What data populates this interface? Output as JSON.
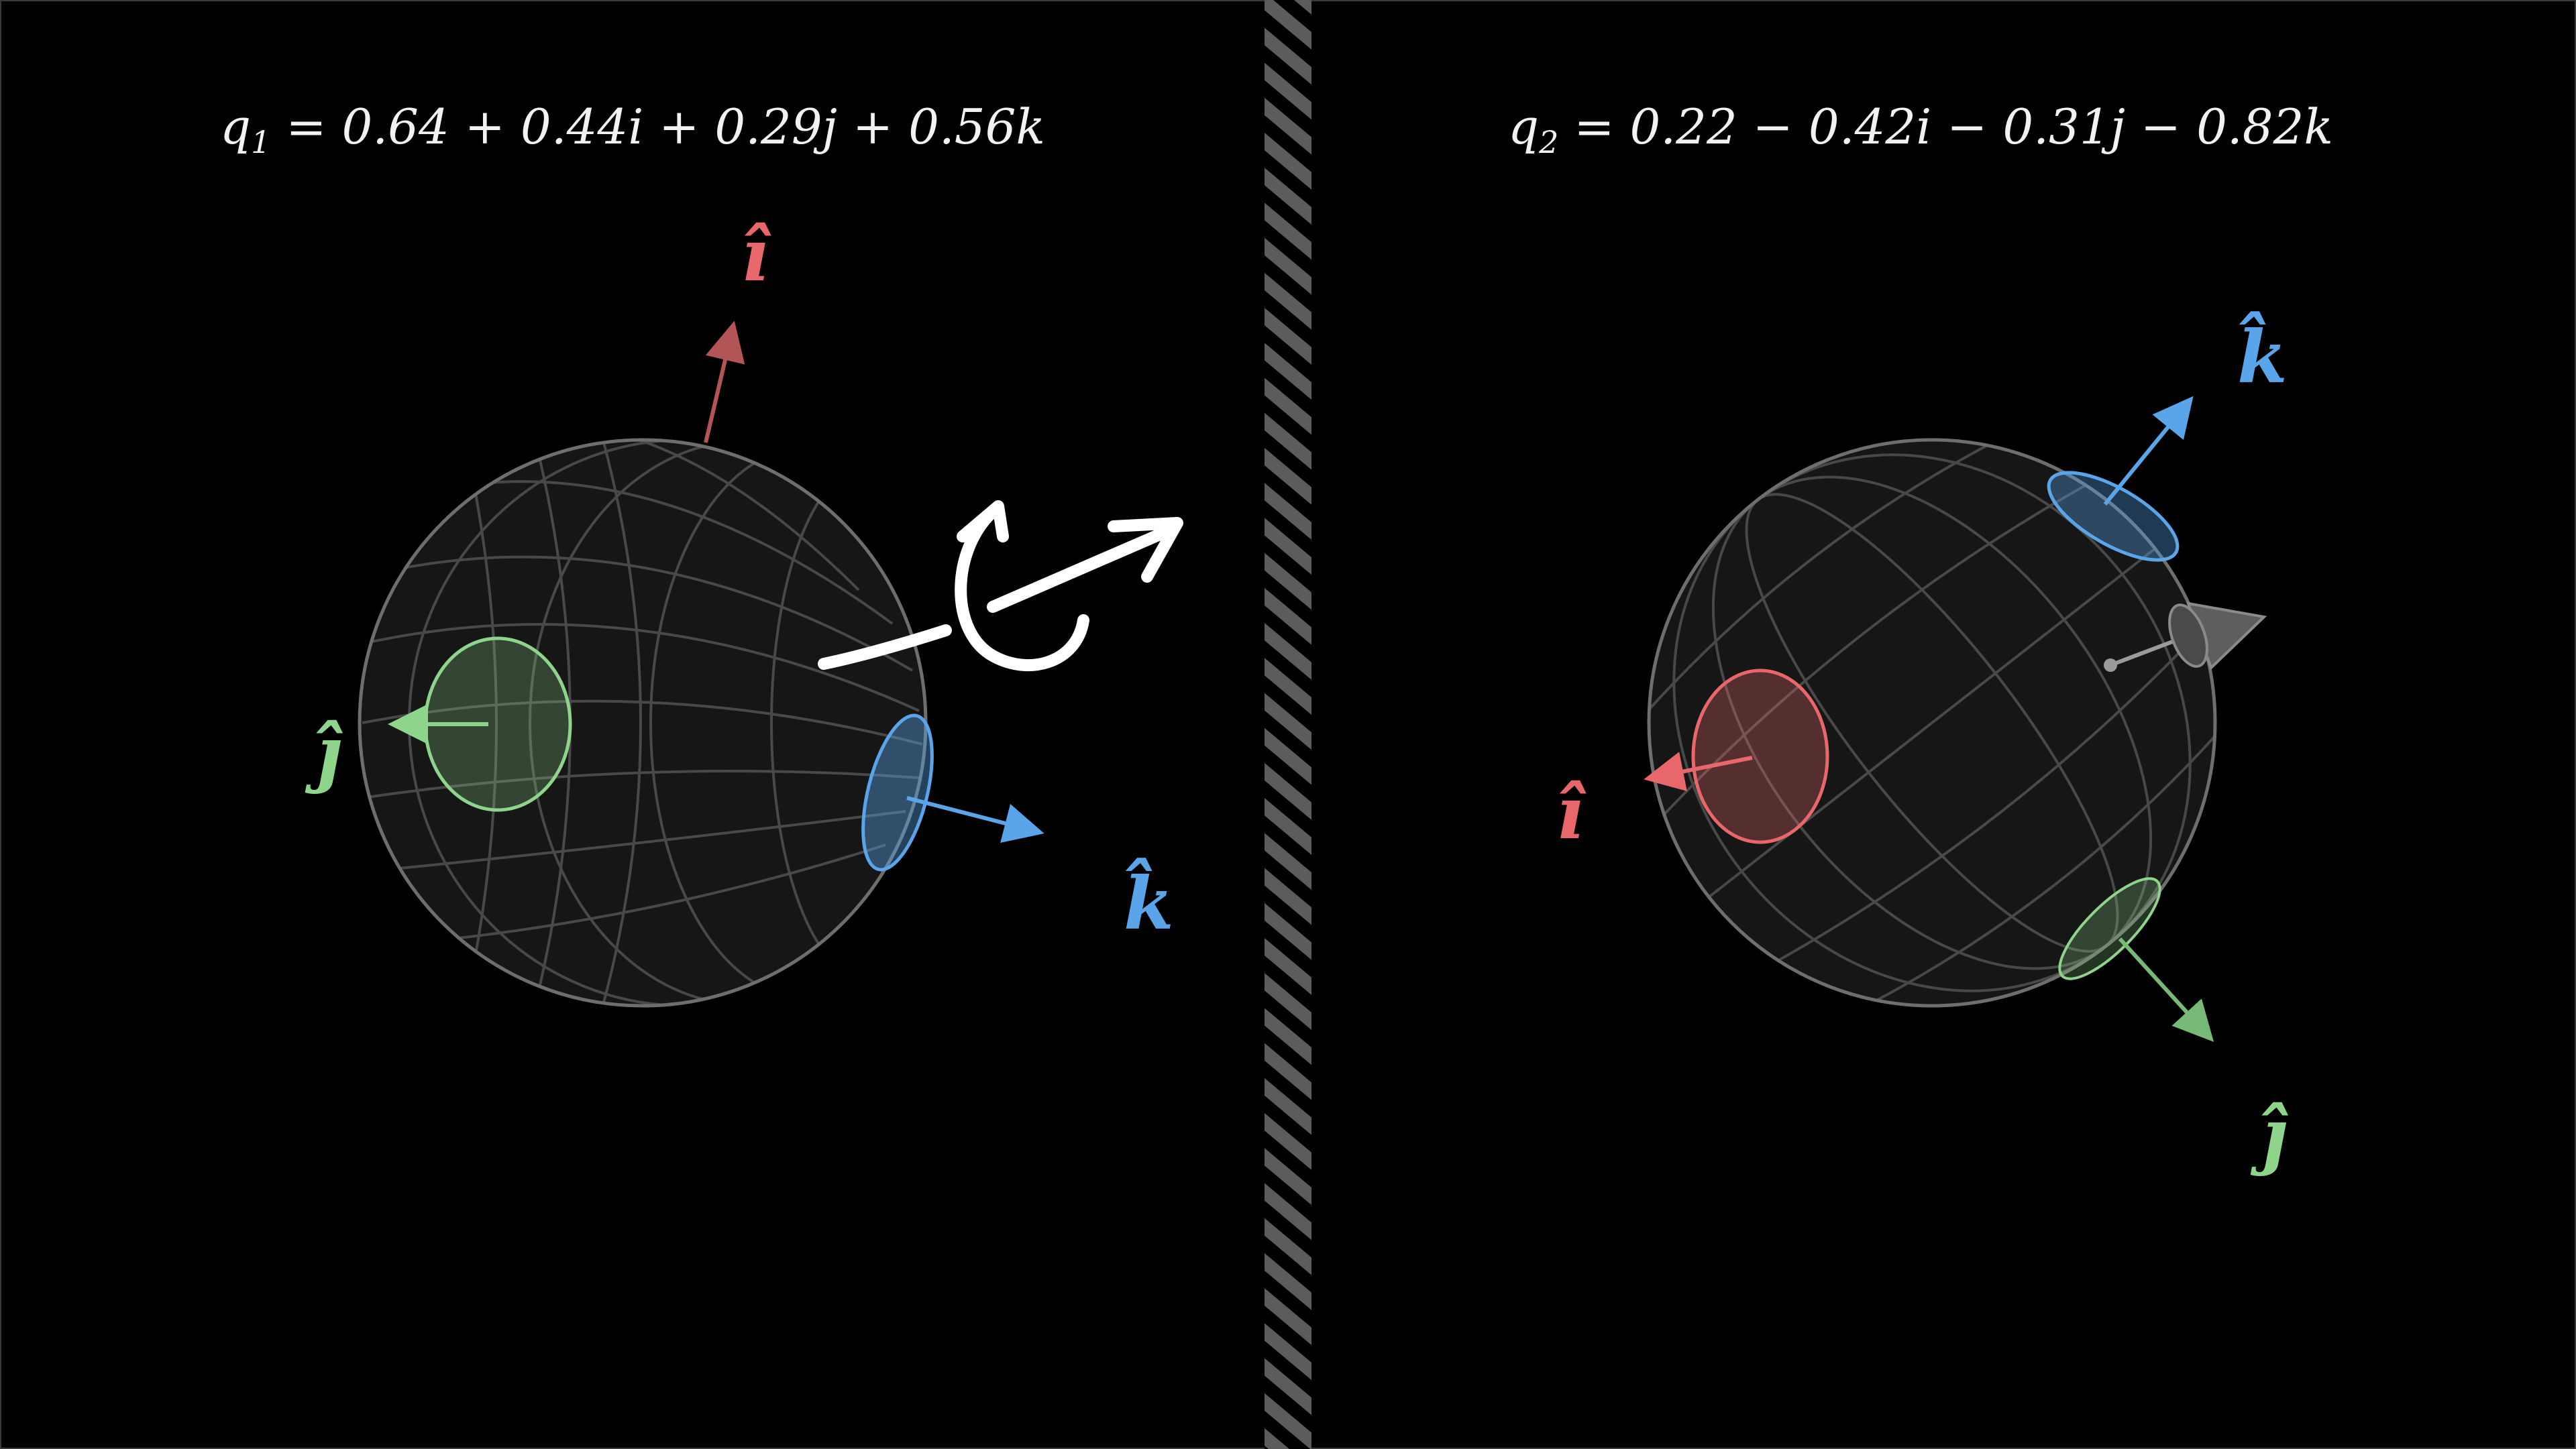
{
  "left_panel": {
    "equation": {
      "symbol": "q",
      "subscript": "1",
      "rhs": " = 0.64 + 0.44i + 0.29j + 0.56k"
    },
    "labels": {
      "i": "î",
      "j": "ĵ",
      "k": "k̂"
    }
  },
  "right_panel": {
    "equation": {
      "symbol": "q",
      "subscript": "2",
      "rhs": " = 0.22 − 0.42i − 0.31j − 0.82k"
    },
    "labels": {
      "i": "î",
      "j": "ĵ",
      "k": "k̂"
    }
  },
  "colors": {
    "background": "#000000",
    "i_axis": "#e8676b",
    "j_axis": "#8fd48b",
    "k_axis": "#5aa5ea",
    "sphere_grid": "#6a6a6a",
    "divider_stripe": "#5c5c5c",
    "rotation_arrow": "#ffffff"
  },
  "icons": {
    "rotation": "rotation-arrow-icon",
    "viewer": "camera-cone-icon"
  }
}
